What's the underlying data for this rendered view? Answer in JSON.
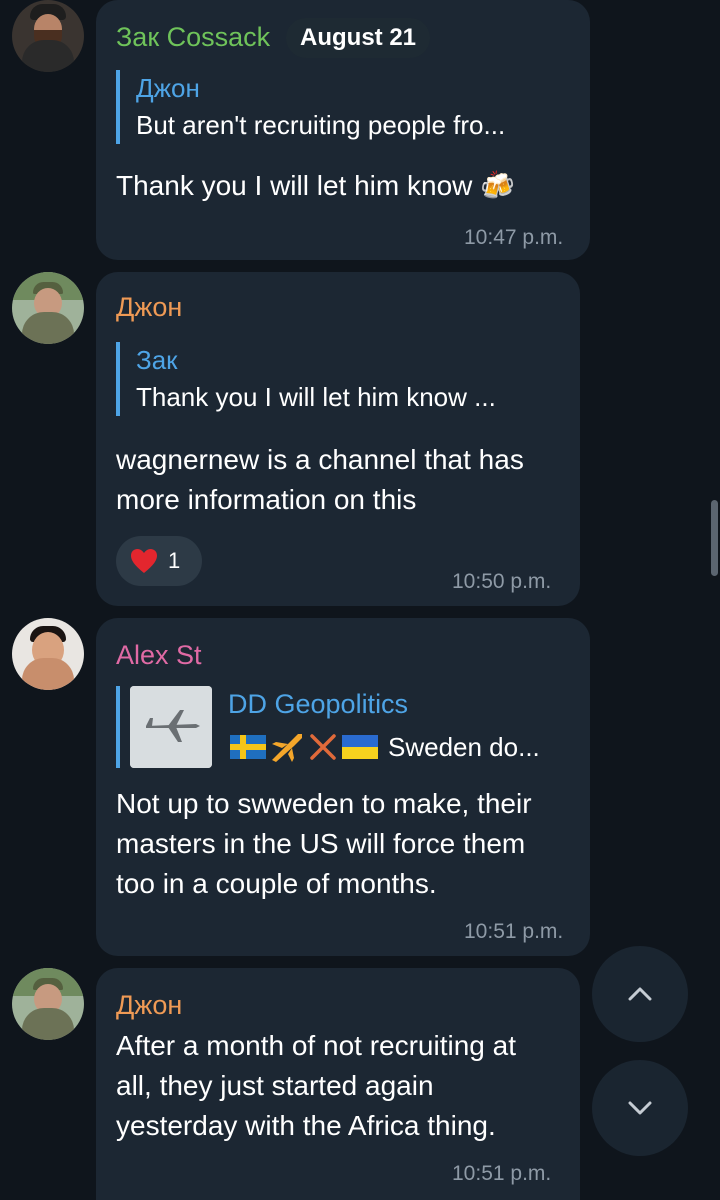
{
  "date_pill": "August 21",
  "messages": [
    {
      "sender": "Зак Cossack",
      "reply": {
        "name": "Джон",
        "text": "But aren't recruiting people fro..."
      },
      "text": "Thank you I will let him know 🍻",
      "time": "10:47 p.m."
    },
    {
      "sender": "Джон",
      "reply": {
        "name": "Зак",
        "text": "Thank you I will let him know ..."
      },
      "lines": [
        "wagnernew is a channel that has",
        "more information on this"
      ],
      "reaction": {
        "icon": "heart-icon",
        "count": "1"
      },
      "time": "10:50 p.m."
    },
    {
      "sender": "Alex St",
      "reply": {
        "name": "DD Geopolitics",
        "text": "Sweden do..."
      },
      "lines": [
        "Not up to swweden to make, their",
        "masters in the US will force them",
        "too in a couple of months."
      ],
      "time": "10:51 p.m."
    },
    {
      "sender": "Джон",
      "lines": [
        "After a month of not recruiting at",
        "all, they just started again",
        "yesterday with the Africa thing."
      ],
      "time": "10:51 p.m."
    }
  ],
  "buttons": {
    "scroll_up": "chevron-up-icon",
    "scroll_down": "chevron-down-icon"
  },
  "colors": {
    "background": "#0f151c",
    "bubble": "#1c2733",
    "sender_green": "#6fc35a",
    "sender_orange": "#ef9a55",
    "sender_pink": "#e06aa5",
    "reply_accent": "#4ea4e6",
    "time": "#8e9aa6"
  }
}
